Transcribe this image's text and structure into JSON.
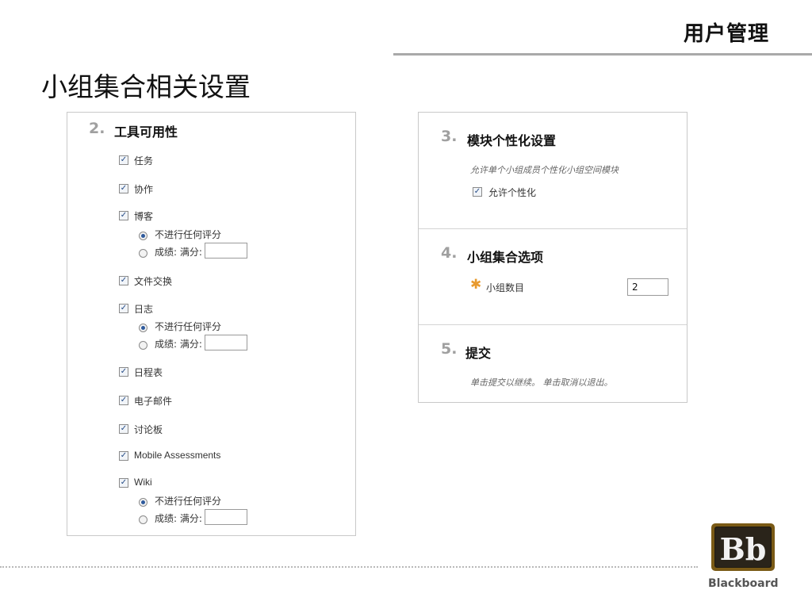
{
  "header": {
    "section_title": "用户管理"
  },
  "page": {
    "title": "小组集合相关设置"
  },
  "tool_availability": {
    "step_number": "2.",
    "title": "工具可用性",
    "check_mark": "✓",
    "items": [
      {
        "label": "任务",
        "checked": true
      },
      {
        "label": "协作",
        "checked": true
      },
      {
        "label": "博客",
        "checked": true,
        "grading": {
          "no_grade": "不进行任何评分",
          "grade": "成绩: 满分:",
          "selected": "no_grade"
        }
      },
      {
        "label": "文件交换",
        "checked": true
      },
      {
        "label": "日志",
        "checked": true,
        "grading": {
          "no_grade": "不进行任何评分",
          "grade": "成绩: 满分:",
          "selected": "no_grade"
        }
      },
      {
        "label": "日程表",
        "checked": true
      },
      {
        "label": "电子邮件",
        "checked": true
      },
      {
        "label": "讨论板",
        "checked": true
      },
      {
        "label": "Mobile Assessments",
        "checked": true
      },
      {
        "label": "Wiki",
        "checked": true,
        "grading": {
          "no_grade": "不进行任何评分",
          "grade": "成绩: 满分:",
          "selected": "no_grade"
        }
      }
    ]
  },
  "module_personalization": {
    "step_number": "3.",
    "title": "模块个性化设置",
    "hint": "允许单个小组成员个性化小组空间模块",
    "checkbox_label": "允许个性化",
    "checked": true
  },
  "group_set_options": {
    "step_number": "4.",
    "title": "小组集合选项",
    "required_mark": "✱",
    "field_label": "小组数目",
    "field_value": "2"
  },
  "submit": {
    "step_number": "5.",
    "title": "提交",
    "hint": "单击提交以继续。 单击取消以退出。"
  },
  "brand": {
    "logo_letters": "Bb",
    "name": "Blackboard"
  },
  "colors": {
    "accent_star": "#e89a2f",
    "step_number": "#a0a0a0",
    "radio_dot": "#2e5a9c"
  }
}
